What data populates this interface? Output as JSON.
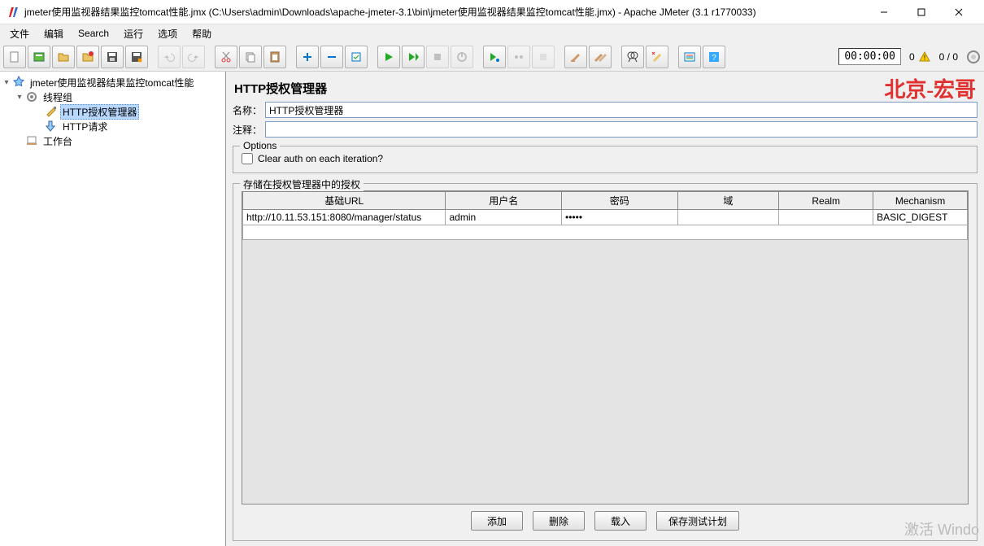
{
  "window": {
    "title": "jmeter使用监视器结果监控tomcat性能.jmx (C:\\Users\\admin\\Downloads\\apache-jmeter-3.1\\bin\\jmeter使用监视器结果监控tomcat性能.jmx) - Apache JMeter (3.1 r1770033)"
  },
  "menu": {
    "items": [
      "文件",
      "编辑",
      "Search",
      "运行",
      "选项",
      "帮助"
    ]
  },
  "toolbar": {
    "timer": "00:00:00",
    "warn_count": "0",
    "thread_status": "0 / 0"
  },
  "tree": {
    "root": "jmeter使用监视器结果监控tomcat性能",
    "thread_group": "线程组",
    "auth_manager": "HTTP授权管理器",
    "http_request": "HTTP请求",
    "workbench": "工作台"
  },
  "panel": {
    "title": "HTTP授权管理器",
    "watermark": "北京-宏哥",
    "name_label": "名称：",
    "name_value": "HTTP授权管理器",
    "comment_label": "注释：",
    "comment_value": "",
    "options_legend": "Options",
    "clear_auth_label": "Clear auth on each iteration?",
    "clear_auth_checked": false,
    "stored_legend": "存储在授权管理器中的授权",
    "columns": [
      "基础URL",
      "用户名",
      "密码",
      "域",
      "Realm",
      "Mechanism"
    ],
    "rows": [
      {
        "url": "http://10.11.53.151:8080/manager/status",
        "user": "admin",
        "pass": "•••••",
        "domain": "",
        "realm": "",
        "mech": "BASIC_DIGEST"
      }
    ],
    "buttons": {
      "add": "添加",
      "delete": "删除",
      "load": "载入",
      "save": "保存测试计划"
    }
  },
  "footer": {
    "activate": "激活 Windo"
  }
}
